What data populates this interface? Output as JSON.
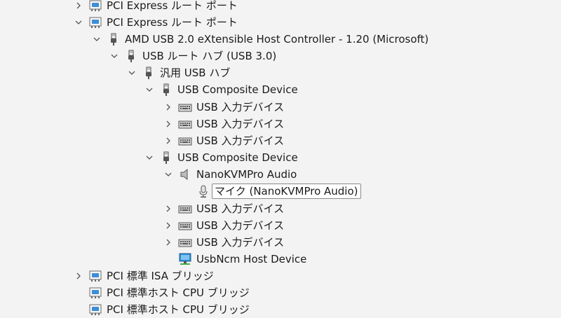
{
  "tree": {
    "items": [
      {
        "label": "PCI Express ルート ポート",
        "icon": "pci-bridge-icon",
        "state": "collapsed"
      },
      {
        "label": "PCI Express ルート ポート",
        "icon": "pci-bridge-icon",
        "state": "expanded"
      },
      {
        "label": "AMD USB 2.0 eXtensible Host Controller - 1.20 (Microsoft)",
        "icon": "usb-plug-icon",
        "state": "expanded"
      },
      {
        "label": "USB ルート ハブ (USB 3.0)",
        "icon": "usb-plug-icon",
        "state": "expanded"
      },
      {
        "label": "汎用 USB ハブ",
        "icon": "usb-plug-icon",
        "state": "expanded"
      },
      {
        "label": "USB Composite Device",
        "icon": "usb-plug-icon",
        "state": "expanded"
      },
      {
        "label": "USB 入力デバイス",
        "icon": "keyboard-device-icon",
        "state": "collapsed"
      },
      {
        "label": "USB 入力デバイス",
        "icon": "keyboard-device-icon",
        "state": "collapsed"
      },
      {
        "label": "USB 入力デバイス",
        "icon": "keyboard-device-icon",
        "state": "collapsed"
      },
      {
        "label": "USB Composite Device",
        "icon": "usb-plug-icon",
        "state": "expanded"
      },
      {
        "label": "NanoKVMPro Audio",
        "icon": "speaker-icon",
        "state": "expanded"
      },
      {
        "label": "マイク (NanoKVMPro Audio)",
        "icon": "microphone-icon",
        "state": "leaf",
        "selected": true
      },
      {
        "label": "USB 入力デバイス",
        "icon": "keyboard-device-icon",
        "state": "collapsed"
      },
      {
        "label": "USB 入力デバイス",
        "icon": "keyboard-device-icon",
        "state": "collapsed"
      },
      {
        "label": "USB 入力デバイス",
        "icon": "keyboard-device-icon",
        "state": "collapsed"
      },
      {
        "label": "UsbNcm Host Device",
        "icon": "network-adapter-icon",
        "state": "leaf"
      },
      {
        "label": "PCI 標準 ISA ブリッジ",
        "icon": "pci-bridge-icon",
        "state": "collapsed"
      },
      {
        "label": "PCI 標準ホスト CPU ブリッジ",
        "icon": "pci-bridge-icon",
        "state": "leaf"
      },
      {
        "label": "PCI 標準ホスト CPU ブリッジ",
        "icon": "pci-bridge-icon",
        "state": "leaf"
      }
    ]
  },
  "colors": {
    "background": "#f3f3f3",
    "selection_border": "#8a8a8a",
    "selection_fill": "#ffffff",
    "network_accent": "#2a8fd6",
    "pci_accent": "#3c8ed8"
  }
}
